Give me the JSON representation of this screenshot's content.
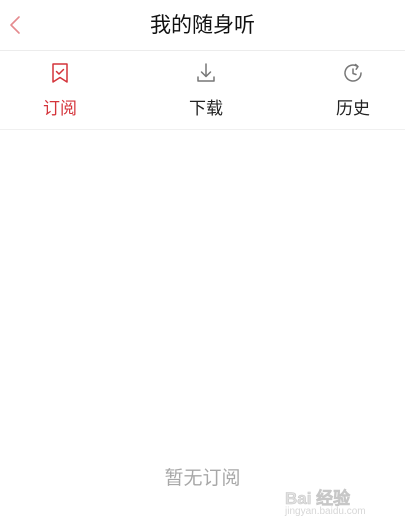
{
  "header": {
    "title": "我的随身听",
    "back_icon": "chevron-left-icon"
  },
  "tabs": [
    {
      "label": "订阅",
      "icon": "bookmark-check-icon",
      "active": true
    },
    {
      "label": "下载",
      "icon": "download-icon",
      "active": false
    },
    {
      "label": "历史",
      "icon": "history-icon",
      "active": false
    }
  ],
  "empty_state": {
    "text": "暂无订阅"
  },
  "watermark": {
    "line1": "Bai 经验",
    "line2": "jingyan.baidu.com"
  },
  "colors": {
    "accent": "#d4333a",
    "title": "#111111",
    "tab_inactive": "#222222",
    "empty_text": "#a8a8a8",
    "divider": "#ececec"
  }
}
